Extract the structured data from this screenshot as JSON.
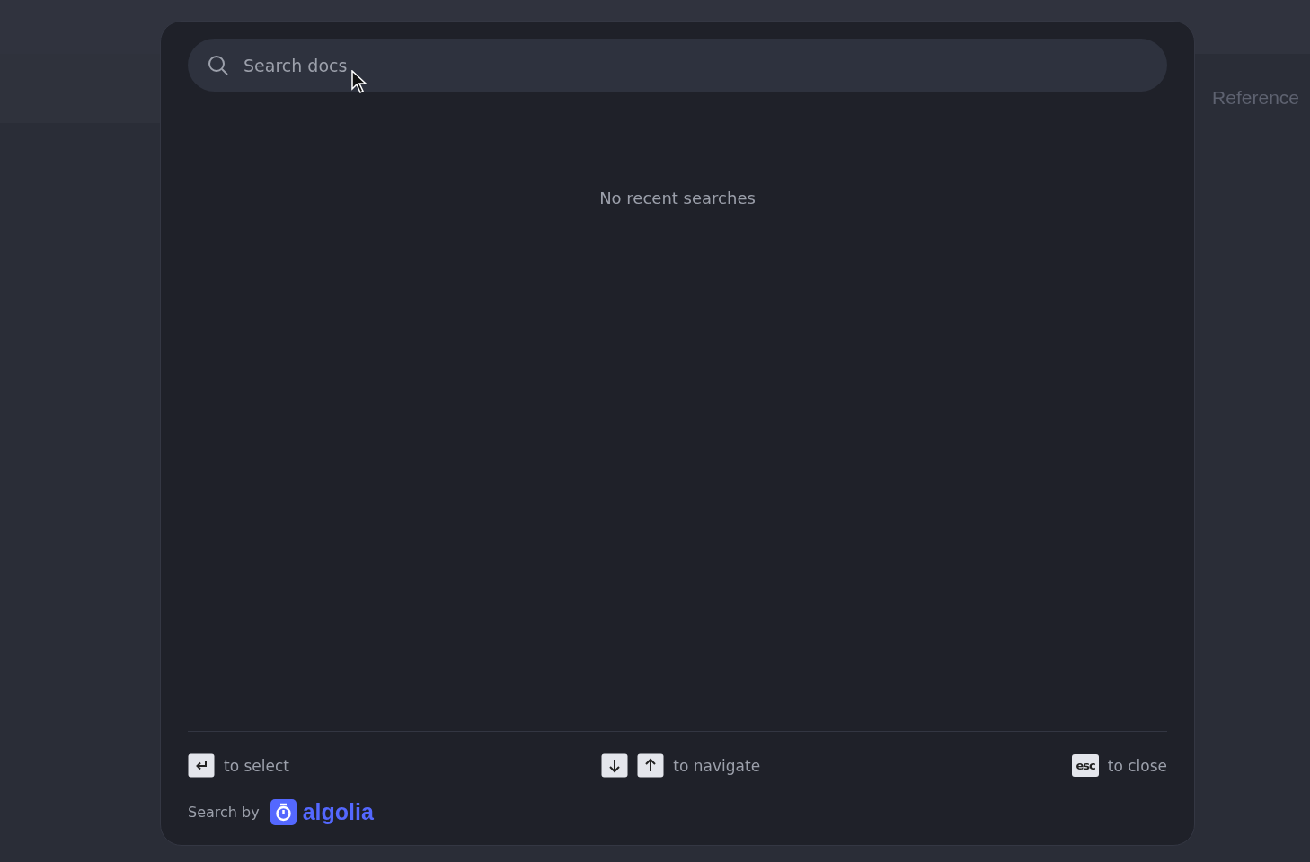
{
  "background": {
    "nav_link": "Reference"
  },
  "search_modal": {
    "search": {
      "placeholder": "Search docs"
    },
    "empty_message": "No recent searches",
    "hints": [
      {
        "kind": "enter",
        "label": "to select"
      },
      {
        "kind": "arrows",
        "label": "to navigate"
      },
      {
        "kind": "esc",
        "key": "esc",
        "label": "to close"
      }
    ],
    "footer": {
      "label": "Search by",
      "logo_text": "algolia"
    }
  }
}
